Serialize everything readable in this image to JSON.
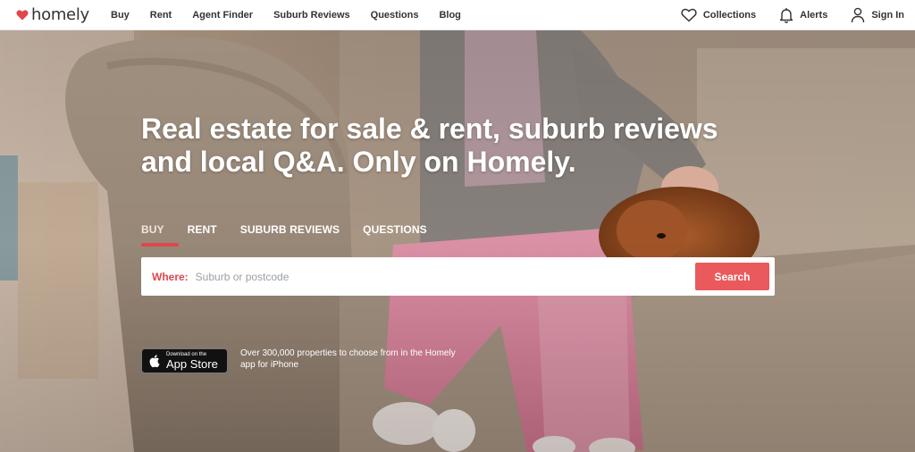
{
  "brand": {
    "name": "homely",
    "color": "#e0474c"
  },
  "nav": {
    "buy": "Buy",
    "rent": "Rent",
    "agent_finder": "Agent Finder",
    "suburb_reviews": "Suburb Reviews",
    "questions": "Questions",
    "blog": "Blog"
  },
  "header_right": {
    "collections": "Collections",
    "alerts": "Alerts",
    "sign_in": "Sign In"
  },
  "hero": {
    "headline_line1": "Real estate for sale & rent, suburb reviews",
    "headline_line2": "and local Q&A. Only on Homely."
  },
  "tabs": {
    "buy": "BUY",
    "rent": "RENT",
    "suburb_reviews": "SUBURB REVIEWS",
    "questions": "QUESTIONS",
    "active": "BUY"
  },
  "search": {
    "label": "Where:",
    "placeholder": "Suburb or postcode",
    "value": "",
    "button": "Search",
    "button_color": "#ea5a5c"
  },
  "app": {
    "badge_small": "Download on the",
    "badge_big": "App Store",
    "description": "Over 300,000 properties to choose from in the Homely app for iPhone"
  },
  "icons": {
    "logo": "heart-house-icon",
    "collections": "heart-icon",
    "alerts": "bell-icon",
    "sign_in": "user-icon",
    "app_store": "apple-icon"
  }
}
